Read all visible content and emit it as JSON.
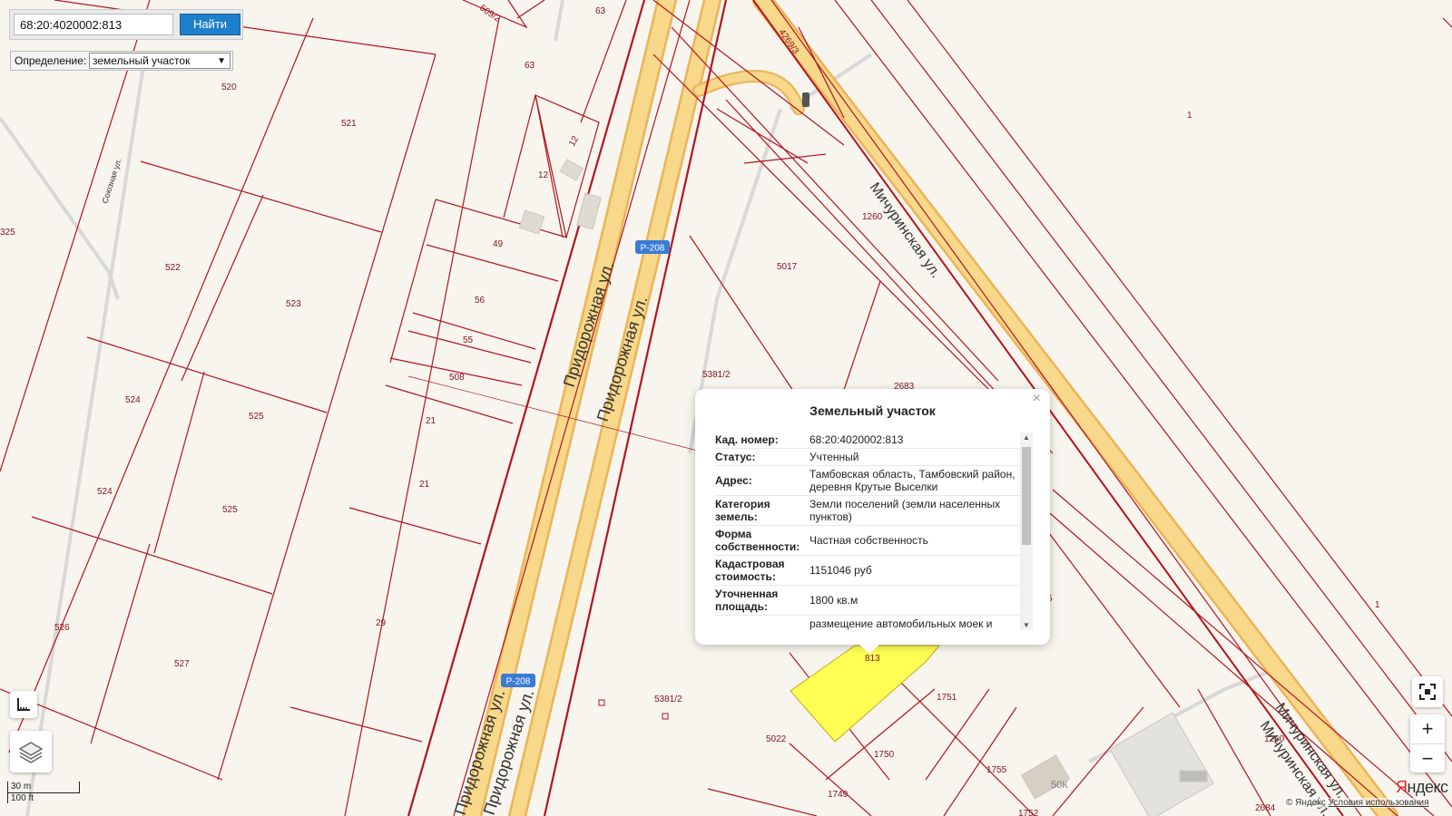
{
  "search": {
    "value": "68:20:4020002:813",
    "button": "Найти"
  },
  "definition": {
    "label": "Определение:",
    "selected": "земельный участок"
  },
  "popup": {
    "title": "Земельный участок",
    "rows": [
      {
        "key": "Кад. номер:",
        "value": "68:20:4020002:813"
      },
      {
        "key": "Статус:",
        "value": "Учтенный"
      },
      {
        "key": "Адрес:",
        "value": "Тамбовская область, Тамбовский район, деревня Крутые Выселки"
      },
      {
        "key": "Категория земель:",
        "value": "Земли поселений (земли населенных пунктов)"
      },
      {
        "key": "Форма собственности:",
        "value": "Частная собственность"
      },
      {
        "key": "Кадастровая стоимость:",
        "value": "1151046 руб"
      },
      {
        "key": "Уточненная площадь:",
        "value": "1800 кв.м"
      },
      {
        "key": "",
        "value": "размещение автомобильных моек и"
      }
    ],
    "close": "×"
  },
  "map": {
    "plot_labels": [
      "520",
      "521",
      "522",
      "523",
      "524",
      "525",
      "524",
      "525",
      "526",
      "527",
      "325",
      "63",
      "63",
      "12",
      "12",
      "49",
      "56",
      "55",
      "508",
      "21",
      "21",
      "29",
      "5017",
      "5381/2",
      "2683",
      "1260",
      "1",
      "1",
      "5381/2",
      "5022",
      "813",
      "1751",
      "1750",
      "1749",
      "1755",
      "1752",
      "2684",
      "1260",
      "4269/3",
      "509/2",
      "5"
    ],
    "road_labels": {
      "pridorozhnaya": "Придорожная ул.",
      "michurinskaya": "Мичуринская ул.",
      "soyuznaya": "Союзная ул.",
      "route": "Р-208",
      "building": "50К"
    },
    "colors": {
      "boundary": "#b4141e",
      "road": "#f8d88a",
      "road_edge": "#eab458",
      "highlight": "#ffff55",
      "background": "#f7f5ee"
    }
  },
  "controls": {
    "zoom_in": "+",
    "zoom_out": "−"
  },
  "scale": {
    "metric": "30 m",
    "imperial": "100 ft"
  },
  "branding": {
    "logo_y": "Я",
    "logo_rest": "ндекс",
    "copyright": "© Яндекс",
    "terms": "Условия использования"
  }
}
